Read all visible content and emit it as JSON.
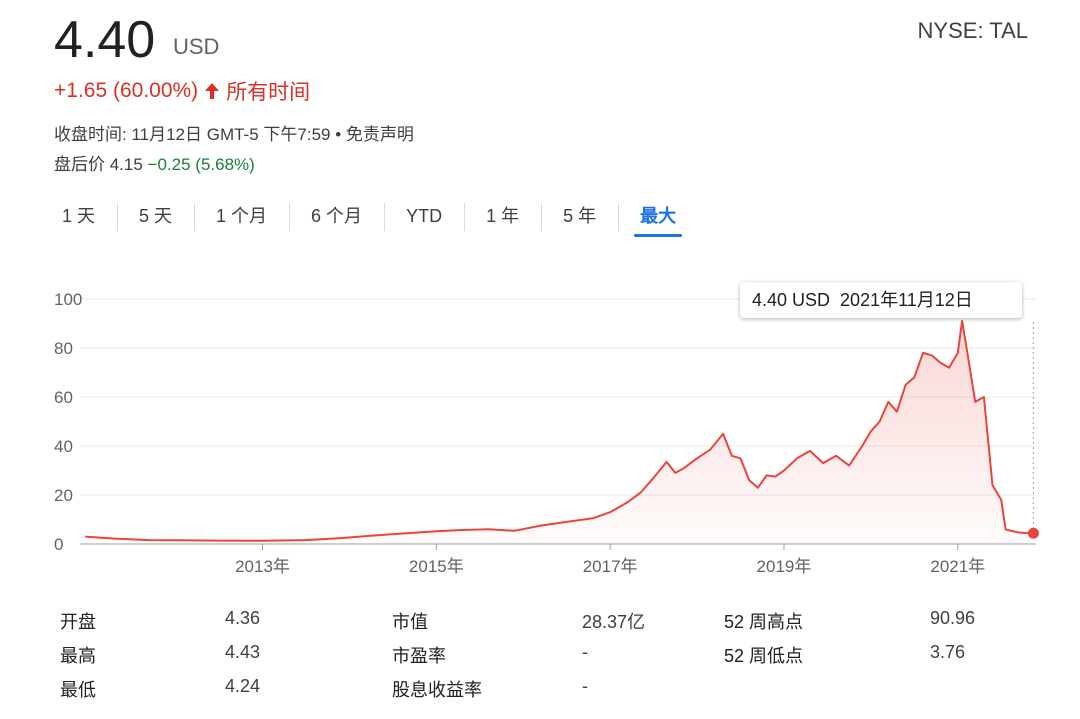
{
  "header": {
    "price": "4.40",
    "currency": "USD",
    "exchange": "NYSE: TAL",
    "change": "+1.65 (60.00%)",
    "change_period": "所有时间",
    "close_info": "收盘时间: 11月12日 GMT-5 下午7:59 • 免责声明",
    "after_hours_label": "盘后价 4.15",
    "after_hours_change": "−0.25 (5.68%)"
  },
  "colors": {
    "up": "#d93025",
    "down": "#188038",
    "accent": "#1a73e8",
    "line": "#e8453c"
  },
  "tabs": [
    {
      "label": "1 天"
    },
    {
      "label": "5 天"
    },
    {
      "label": "1 个月"
    },
    {
      "label": "6 个月"
    },
    {
      "label": "YTD"
    },
    {
      "label": "1 年"
    },
    {
      "label": "5 年"
    },
    {
      "label": "最大",
      "active": true
    }
  ],
  "tooltip": {
    "price": "4.40 USD",
    "date": "2021年11月12日"
  },
  "chart_data": {
    "type": "area",
    "x_tick_labels": [
      "2013年",
      "2015年",
      "2017年",
      "2019年",
      "2021年"
    ],
    "x_ticks": [
      2013,
      2015,
      2017,
      2019,
      2021
    ],
    "y_ticks": [
      0,
      20,
      40,
      60,
      80,
      100
    ],
    "ylim": [
      0,
      100
    ],
    "xlim": [
      2010.9,
      2021.9
    ],
    "series": [
      {
        "x": [
          2010.96,
          2011.3,
          2011.7,
          2012.0,
          2012.5,
          2013.0,
          2013.5,
          2013.9,
          2014.3,
          2014.7,
          2015.0,
          2015.3,
          2015.6,
          2015.9,
          2016.2,
          2016.5,
          2016.8,
          2017.0,
          2017.2,
          2017.35,
          2017.5,
          2017.65,
          2017.75,
          2017.85,
          2018.0,
          2018.15,
          2018.3,
          2018.4,
          2018.5,
          2018.6,
          2018.7,
          2018.8,
          2018.9,
          2019.0,
          2019.15,
          2019.3,
          2019.45,
          2019.6,
          2019.75,
          2019.9,
          2020.0,
          2020.1,
          2020.2,
          2020.3,
          2020.4,
          2020.5,
          2020.6,
          2020.7,
          2020.8,
          2020.9,
          2021.0,
          2021.05,
          2021.12,
          2021.2,
          2021.3,
          2021.4,
          2021.5,
          2021.55,
          2021.6,
          2021.7,
          2021.8,
          2021.87
        ],
        "values": [
          3.0,
          2.2,
          1.6,
          1.5,
          1.4,
          1.3,
          1.6,
          2.4,
          3.5,
          4.5,
          5.2,
          5.7,
          6.0,
          5.4,
          7.5,
          9.0,
          10.5,
          13.0,
          17.0,
          21.0,
          27.0,
          33.5,
          29.0,
          31.0,
          35.0,
          38.5,
          45.0,
          36.0,
          35.0,
          26.0,
          23.0,
          28.0,
          27.5,
          30.0,
          35.0,
          38.0,
          33.0,
          36.0,
          32.0,
          40.0,
          46.0,
          50.0,
          58.0,
          54.0,
          65.0,
          68.0,
          78.0,
          77.0,
          74.0,
          72.0,
          78.0,
          91.0,
          76.0,
          58.0,
          60.0,
          24.0,
          18.0,
          6.0,
          5.5,
          4.7,
          4.5,
          4.4
        ]
      }
    ]
  },
  "stats": [
    {
      "label": "开盘",
      "value": "4.36"
    },
    {
      "label": "最高",
      "value": "4.43"
    },
    {
      "label": "最低",
      "value": "4.24"
    },
    {
      "label": "市值",
      "value": "28.37亿"
    },
    {
      "label": "市盈率",
      "value": "-"
    },
    {
      "label": "股息收益率",
      "value": "-"
    },
    {
      "label": "52 周高点",
      "value": "90.96"
    },
    {
      "label": "52 周低点",
      "value": "3.76"
    }
  ]
}
